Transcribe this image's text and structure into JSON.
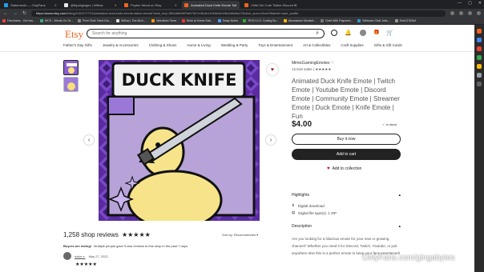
{
  "browser": {
    "tabs": [
      {
        "title": "Statements — OnlyFans",
        "color": "#1da1f2",
        "active": false
      },
      {
        "title": "@thjustgingee | Willow",
        "color": "#e8e8e8",
        "active": false
      },
      {
        "title": "Peyton Wood on Etsy",
        "color": "#f1641e",
        "active": false
      },
      {
        "title": "Animated Duck Knife Emote Twi",
        "color": "#f1641e",
        "active": true
      },
      {
        "title": "Chibi Girl Cute Twitch Discord E",
        "color": "#f1641e",
        "active": false
      }
    ],
    "url_host": "https://www.etsy.com",
    "url_path": "/listing/1161177721/animated-duck-knife-emote-twitch-emote?click_key=3f04a5b9f07fa573e7e3fc3e1b7b8e9e1f8c2d8a5a17&click_sum=d1ea7f8a&ref=user_profile",
    "bookmarks": [
      {
        "label": "Fanchains - Get rea...",
        "color": "#e44"
      },
      {
        "label": "WCS - Words On St...",
        "color": "#4a8"
      },
      {
        "label": "Pixel Chat: Nerd Gru...",
        "color": "#888"
      },
      {
        "label": "Willow | The All-in-...",
        "color": "#ddd"
      },
      {
        "label": "Marathon Timer",
        "color": "#f90"
      },
      {
        "label": "Work at Home Dail...",
        "color": "#e33"
      },
      {
        "label": "Swap Notes",
        "color": "#59f"
      },
      {
        "label": "TECH U.S. Coding Bo...",
        "color": "#3a3"
      },
      {
        "label": "Abundance Mindset...",
        "color": "#fb0"
      },
      {
        "label": "Debt With Payment...",
        "color": "#777"
      },
      {
        "label": "Webcam Chat Jobs...",
        "color": "#39c"
      },
      {
        "label": "Test12763wf",
        "color": "#999"
      }
    ]
  },
  "header": {
    "logo": "Etsy",
    "search_placeholder": "Search for anything"
  },
  "categories": [
    "Father's Day Gifts",
    "Jewelry & Accessories",
    "Clothing & Shoes",
    "Home & Living",
    "Wedding & Party",
    "Toys & Entertainment",
    "Art & Collectibles",
    "Craft Supplies",
    "Gifts & Gift Cards"
  ],
  "listing": {
    "shop_name": "MimicGamingEmotes",
    "sales": "12,518 sales",
    "rating": 5,
    "title": "Animated Duck Knife Emote | Twitch Emote | Youtube Emote | Discord Emote | Community Emote | Streamer Emote | Duck Emote | Knife Emote | Fun",
    "price": "$4.00",
    "stock": "In stock",
    "buy_now": "Buy it now",
    "add_to_cart": "Add to cart",
    "add_to_collection": "Add to collection",
    "image_text": "DUCK KNIFE",
    "highlights_title": "Highlights",
    "highlights": [
      "Digital download",
      "Digital file type(s): 1 ZIP"
    ],
    "description_title": "Description",
    "description_snippet": "Are you looking for a hilarious emote for your new or growing channel? Whether you need it for Discord, Twitch, Youtube, or just anywhere else this is a perfect emote to keep your fans entertained!"
  },
  "reviews": {
    "count_label": "1,258 shop reviews",
    "stars": "★★★★★",
    "sort_label": "Sort by: Recommended",
    "buyers_label": "Buyers are raving!",
    "buyers_text": "Multiple people gave 5-star reviews to this shop in the past 7 days.",
    "first_reviewer": "dakis s.",
    "first_date": "May 27, 2022",
    "first_stars": "★★★★★"
  },
  "watermark": "OnlyFans.com/gingabytes",
  "sidebar_colors": [
    "#f1641e",
    "#4285f4",
    "#ea4335",
    "#34a853",
    "#fbbc05",
    "#9aa0a6",
    "#5f6368"
  ]
}
